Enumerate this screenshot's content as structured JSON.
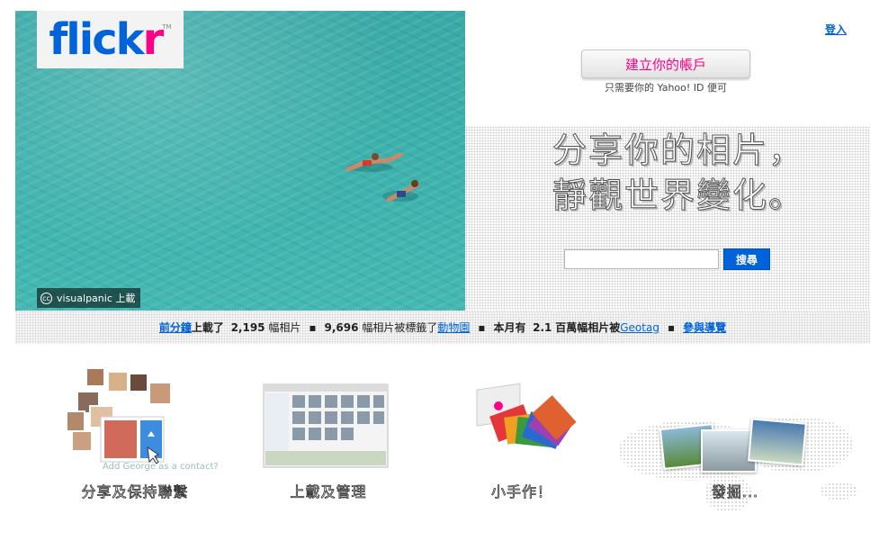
{
  "logo": {
    "part1": "flick",
    "part2": "r",
    "tm": "TM"
  },
  "hero": {
    "credit": "visualpanic 上載"
  },
  "header": {
    "signin": "登入"
  },
  "account": {
    "create_label": "建立你的帳戶",
    "yahoo_note": "只需要你的 Yahoo! ID 便可"
  },
  "tagline": {
    "line1": "分享你的相片，",
    "line2": "靜觀世界變化。"
  },
  "search": {
    "value": "",
    "button": "搜尋"
  },
  "stats": {
    "link_minute": "前分鐘",
    "uploaded": "上載了",
    "count1": "2,195",
    "unit1": "幅相片",
    "count2": "9,696",
    "unit2": "幅相片被標籤了",
    "link_animals": "動物園",
    "this_month": "本月有",
    "count3": "2.1",
    "unit3": "百萬幅相片被",
    "link_geotag": "Geotag",
    "link_tour": "參與導覽"
  },
  "features": {
    "share": {
      "label": "分享及保持聯繫",
      "caption": "Add George as a contact?"
    },
    "upload": {
      "label": "上載及管理"
    },
    "make": {
      "label": "小手作！"
    },
    "explore": {
      "label": "發掘..."
    }
  },
  "colors": {
    "flickr_blue": "#0063dc",
    "flickr_pink": "#ff0084"
  }
}
